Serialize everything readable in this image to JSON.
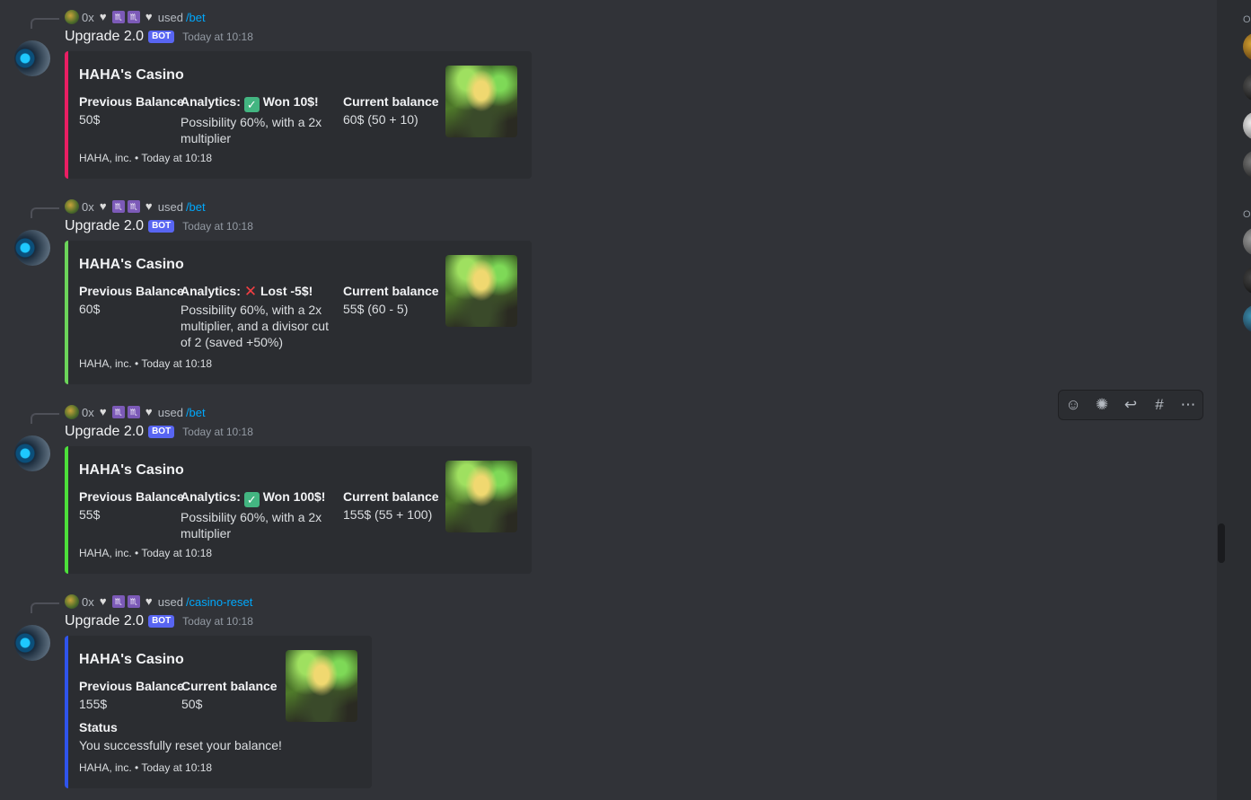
{
  "messages": [
    {
      "reply_user": "0x",
      "reply_used": "used",
      "command": "/bet",
      "bot_name": "Upgrade 2.0",
      "bot_tag": "BOT",
      "timestamp": "Today at 10:18",
      "accent_color": "#e91e63",
      "embed": {
        "title": "HAHA's Casino",
        "prev_label": "Previous Balance",
        "prev_value": "50$",
        "analytics_label": "Analytics:",
        "analytics_icon": "check-mark",
        "analytics_result": "Won 10$!",
        "analytics_detail": "Possibility 60%, with a 2x multiplier",
        "curr_label": "Current balance",
        "curr_value": "60$ (50 + 10)",
        "footer": "HAHA, inc. • Today at 10:18"
      }
    },
    {
      "reply_user": "0x",
      "reply_used": "used",
      "command": "/bet",
      "bot_name": "Upgrade 2.0",
      "bot_tag": "BOT",
      "timestamp": "Today at 10:18",
      "accent_color": "#6bd45a",
      "embed": {
        "title": "HAHA's Casino",
        "prev_label": "Previous Balance",
        "prev_value": "60$",
        "analytics_label": "Analytics:",
        "analytics_icon": "cross-mark",
        "analytics_result": "Lost -5$!",
        "analytics_detail": "Possibility 60%, with a 2x multiplier, and a divisor cut of 2 (saved +50%)",
        "curr_label": "Current balance",
        "curr_value": "55$ (60 - 5)",
        "footer": "HAHA, inc. • Today at 10:18"
      }
    },
    {
      "reply_user": "0x",
      "reply_used": "used",
      "command": "/bet",
      "bot_name": "Upgrade 2.0",
      "bot_tag": "BOT",
      "timestamp": "Today at 10:18",
      "accent_color": "#4ce03a",
      "embed": {
        "title": "HAHA's Casino",
        "prev_label": "Previous Balance",
        "prev_value": "55$",
        "analytics_label": "Analytics:",
        "analytics_icon": "check-mark",
        "analytics_result": "Won 100$!",
        "analytics_detail": "Possibility 60%, with a 2x multiplier",
        "curr_label": "Current balance",
        "curr_value": "155$ (55 + 100)",
        "footer": "HAHA, inc. • Today at 10:18"
      }
    },
    {
      "reply_user": "0x",
      "reply_used": "used",
      "command": "/casino-reset",
      "bot_name": "Upgrade 2.0",
      "bot_tag": "BOT",
      "timestamp": "Today at 10:18",
      "accent_color": "#2f54eb",
      "embed": {
        "title": "HAHA's Casino",
        "prev_label": "Previous Balance",
        "prev_value": "155$",
        "curr_label": "Current balance",
        "curr_value": "50$",
        "status_label": "Status",
        "status_value": "You successfully reset your balance!",
        "footer": "HAHA, inc. • Today at 10:18"
      }
    }
  ],
  "toolbar": {
    "icons": [
      "add-reaction-icon",
      "super-reaction-icon",
      "reply-icon",
      "create-thread-icon",
      "more-icon"
    ]
  },
  "member_list": {
    "group_labels": [
      "O",
      "O"
    ]
  }
}
